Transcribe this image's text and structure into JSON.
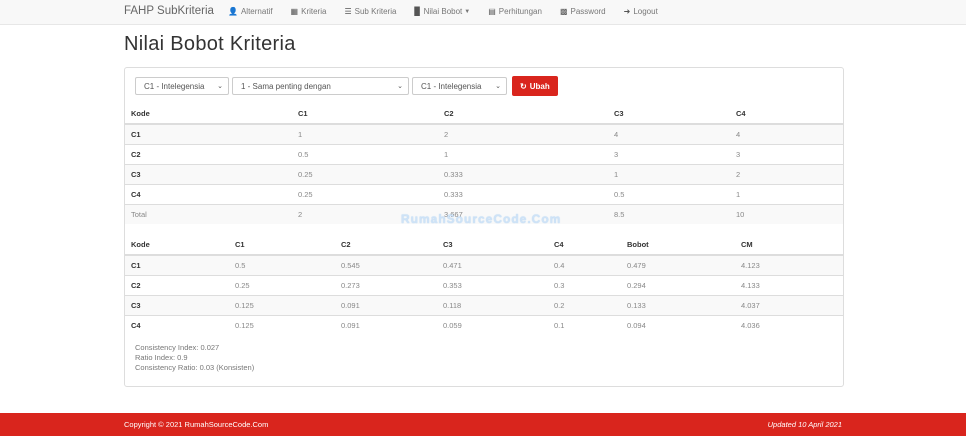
{
  "brand": "FAHP SubKriteria",
  "nav": [
    {
      "icon": "user-icon",
      "label": "Alternatif"
    },
    {
      "icon": "grid-icon",
      "label": "Kriteria"
    },
    {
      "icon": "list-icon",
      "label": "Sub Kriteria"
    },
    {
      "icon": "bar-chart-icon",
      "label": "Nilai Bobot"
    },
    {
      "icon": "calendar-icon",
      "label": "Perhitungan"
    },
    {
      "icon": "lock-icon",
      "label": "Password"
    },
    {
      "icon": "logout-icon",
      "label": "Logout"
    }
  ],
  "title": "Nilai Bobot Kriteria",
  "form": {
    "select1": "C1 - Intelegensia",
    "select2": "1 - Sama penting dengan",
    "select3": "C1 - Intelegensia",
    "button": "Ubah"
  },
  "table1": {
    "headers": [
      "Kode",
      "C1",
      "C2",
      "C3",
      "C4"
    ],
    "rows": [
      [
        "C1",
        "1",
        "2",
        "4",
        "4"
      ],
      [
        "C2",
        "0.5",
        "1",
        "3",
        "3"
      ],
      [
        "C3",
        "0.25",
        "0.333",
        "1",
        "2"
      ],
      [
        "C4",
        "0.25",
        "0.333",
        "0.5",
        "1"
      ],
      [
        "Total",
        "2",
        "3.667",
        "8.5",
        "10"
      ]
    ]
  },
  "watermark": "RumahSourceCode.Com",
  "table2": {
    "headers": [
      "Kode",
      "C1",
      "C2",
      "C3",
      "C4",
      "Bobot",
      "CM"
    ],
    "rows": [
      [
        "C1",
        "0.5",
        "0.545",
        "0.471",
        "0.4",
        "0.479",
        "4.123"
      ],
      [
        "C2",
        "0.25",
        "0.273",
        "0.353",
        "0.3",
        "0.294",
        "4.133"
      ],
      [
        "C3",
        "0.125",
        "0.091",
        "0.118",
        "0.2",
        "0.133",
        "4.037"
      ],
      [
        "C4",
        "0.125",
        "0.091",
        "0.059",
        "0.1",
        "0.094",
        "4.036"
      ]
    ]
  },
  "consistency": {
    "ci": "Consistency Index: 0.027",
    "ri": "Ratio Index: 0.9",
    "cr": "Consistency Ratio: 0.03 (Konsisten)"
  },
  "footer": {
    "copyright": "Copyright © 2021 RumahSourceCode.Com",
    "updated": "Updated 10 April 2021"
  }
}
